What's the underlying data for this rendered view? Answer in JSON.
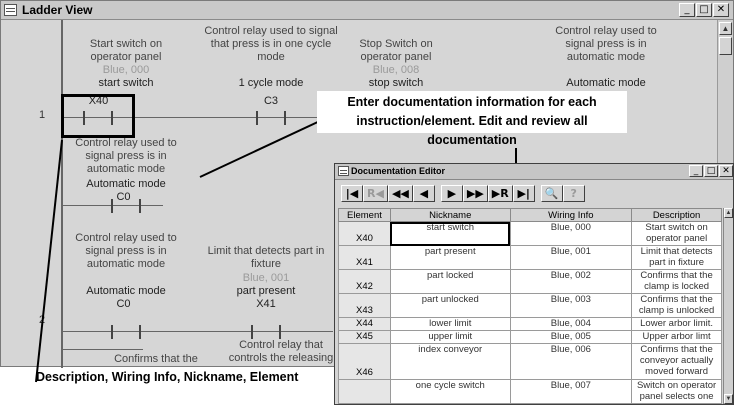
{
  "ladder": {
    "title": "Ladder View",
    "rung1": "1",
    "rung2": "2",
    "elements": {
      "x40": {
        "desc": "Start switch on operator panel",
        "wiring": "Blue, 000",
        "nick": "start switch",
        "addr": "X40"
      },
      "c3": {
        "desc": "Control relay used to signal that press is in one cycle mode",
        "nick": "1 cycle mode",
        "addr": "C3"
      },
      "x_stop": {
        "desc": "Stop Switch on operator panel",
        "wiring": "Blue, 008",
        "nick": "stop switch"
      },
      "c_auto_top": {
        "desc": "Control relay used to signal press is in automatic mode",
        "nick": "Automatic mode"
      },
      "c0_a": {
        "desc": "Control relay used to signal press is in automatic mode",
        "nick": "Automatic mode",
        "addr": "C0"
      },
      "c0_b": {
        "desc": "Control relay used to signal press is in automatic mode",
        "nick": "Automatic mode",
        "addr": "C0"
      },
      "x41": {
        "desc": "Limit that detects part in fixture",
        "wiring": "Blue, 001",
        "nick": "part present",
        "addr": "X41"
      },
      "confirms": {
        "desc": "Confirms that the"
      },
      "releasing": {
        "desc": "Control relay that controls the releasing"
      }
    }
  },
  "callouts": {
    "top": "Enter documentation information for each instruction/element. Edit and review all documentation",
    "bottom": "Description, Wiring Info, Nickname, Element"
  },
  "editor": {
    "title": "Documentation Editor",
    "toolbar": [
      "|◀",
      "R◀",
      "◀◀",
      "◀",
      "▶",
      "▶▶",
      "▶R",
      "▶|",
      "🔍",
      "?"
    ],
    "columns": [
      "Element",
      "Nickname",
      "Wiring Info",
      "Description"
    ],
    "rows": [
      {
        "element": "X40",
        "nickname": "start switch",
        "wiring": "Blue, 000",
        "description": "Start switch on operator panel"
      },
      {
        "element": "X41",
        "nickname": "part present",
        "wiring": "Blue, 001",
        "description": "Limit that detects part in fixture"
      },
      {
        "element": "X42",
        "nickname": "part locked",
        "wiring": "Blue, 002",
        "description": "Confirms that the clamp is locked"
      },
      {
        "element": "X43",
        "nickname": "part unlocked",
        "wiring": "Blue, 003",
        "description": "Confirms that the clamp is unlocked"
      },
      {
        "element": "X44",
        "nickname": "lower limit",
        "wiring": "Blue, 004",
        "description": "Lower arbor limit."
      },
      {
        "element": "X45",
        "nickname": "upper limit",
        "wiring": "Blue, 005",
        "description": "Upper arbor limt"
      },
      {
        "element": "X46",
        "nickname": "index conveyor",
        "wiring": "Blue, 006",
        "description": "Confirms that the conveyor actually moved forward"
      },
      {
        "element": "",
        "nickname": "one cycle switch",
        "wiring": "Blue, 007",
        "description": "Switch on operator panel selects one"
      }
    ]
  }
}
